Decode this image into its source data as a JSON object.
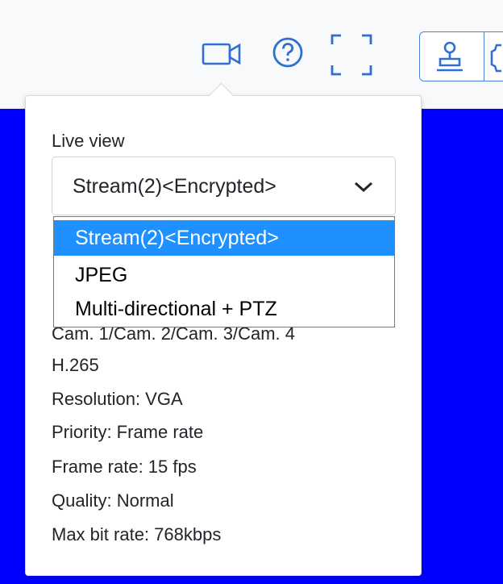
{
  "toolbar": {
    "icons": [
      "camera-icon",
      "help-icon",
      "fullscreen-icon",
      "stamp-icon",
      "gear-icon"
    ],
    "accent_color": "#2f6fd0"
  },
  "background": {
    "color": "#0000ff"
  },
  "live_view": {
    "label": "Live view",
    "selected_value": "Stream(2)<Encrypted>",
    "options": [
      "Stream(2)<Encrypted>",
      "JPEG",
      "Multi-directional + PTZ"
    ],
    "highlight_color": "#1e90ff"
  },
  "stream_info": [
    "Cam. 1/Cam. 2/Cam. 3/Cam. 4",
    "H.265",
    "Resolution: VGA",
    "Priority: Frame rate",
    "Frame rate: 15 fps",
    "Quality: Normal",
    "Max bit rate: 768kbps"
  ]
}
